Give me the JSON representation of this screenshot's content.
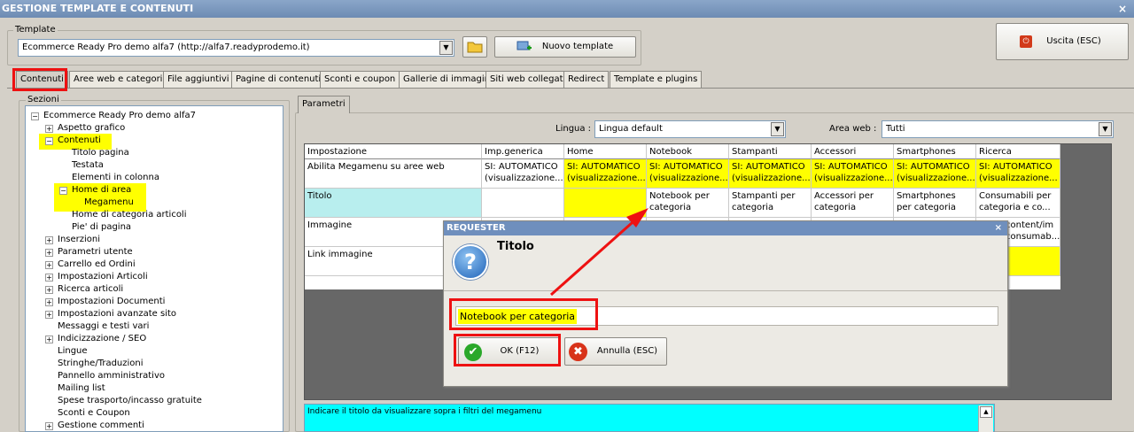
{
  "window": {
    "title": "GESTIONE TEMPLATE E CONTENUTI",
    "close": "×"
  },
  "template_group": {
    "legend": "Template",
    "selected": "Ecommerce Ready Pro demo alfa7 (http://alfa7.readyprodemo.it)",
    "new_button": "Nuovo template"
  },
  "exit_button": "Uscita (ESC)",
  "tabs": [
    "Contenuti",
    "Aree web e categorie",
    "File aggiuntivi",
    "Pagine di contenuti",
    "Sconti e coupon",
    "Gallerie di immagini",
    "Siti web collegati",
    "Redirect",
    "Template e plugins"
  ],
  "sections": {
    "legend": "Sezioni",
    "tree": [
      {
        "label": "Ecommerce Ready Pro demo alfa7",
        "exp": "−"
      },
      {
        "label": "Aspetto grafico",
        "exp": "+"
      },
      {
        "label": "Contenuti",
        "exp": "−"
      },
      {
        "label": "Titolo pagina",
        "exp": ""
      },
      {
        "label": "Testata",
        "exp": ""
      },
      {
        "label": "Elementi in colonna",
        "exp": ""
      },
      {
        "label": "Home di area",
        "exp": "−"
      },
      {
        "label": "Megamenu",
        "exp": ""
      },
      {
        "label": "Home di categoria articoli",
        "exp": ""
      },
      {
        "label": "Pie' di pagina",
        "exp": ""
      },
      {
        "label": "Inserzioni",
        "exp": "+"
      },
      {
        "label": "Parametri utente",
        "exp": "+"
      },
      {
        "label": "Carrello ed Ordini",
        "exp": "+"
      },
      {
        "label": "Impostazioni Articoli",
        "exp": "+"
      },
      {
        "label": "Ricerca articoli",
        "exp": "+"
      },
      {
        "label": "Impostazioni Documenti",
        "exp": "+"
      },
      {
        "label": "Impostazioni avanzate sito",
        "exp": "+"
      },
      {
        "label": "Messaggi e testi vari",
        "exp": ""
      },
      {
        "label": "Indicizzazione / SEO",
        "exp": "+"
      },
      {
        "label": "Lingue",
        "exp": ""
      },
      {
        "label": "Stringhe/Traduzioni",
        "exp": ""
      },
      {
        "label": "Pannello amministrativo",
        "exp": ""
      },
      {
        "label": "Mailing list",
        "exp": ""
      },
      {
        "label": "Spese trasporto/incasso gratuite",
        "exp": ""
      },
      {
        "label": "Sconti e Coupon",
        "exp": ""
      },
      {
        "label": "Gestione commenti",
        "exp": "+"
      }
    ]
  },
  "params": {
    "tab": "Parametri",
    "lingua_label": "Lingua :",
    "lingua_value": "Lingua default",
    "area_label": "Area web :",
    "area_value": "Tutti",
    "columns": [
      "Impostazione",
      "Imp.generica",
      "Home",
      "Notebook",
      "Stampanti",
      "Accessori",
      "Smartphones",
      "Ricerca consum..."
    ],
    "rows": [
      [
        "Abilita Megamenu su aree web",
        "SI: AUTOMATICO (visualizzazione...",
        "SI: AUTOMATICO (visualizzazione...",
        "SI: AUTOMATICO (visualizzazione...",
        "SI: AUTOMATICO (visualizzazione...",
        "SI: AUTOMATICO (visualizzazione...",
        "SI: AUTOMATICO (visualizzazione...",
        "SI: AUTOMATICO (visualizzazione..."
      ],
      [
        "Titolo",
        "",
        "",
        "Notebook per categoria",
        "Stampanti per categoria",
        "Accessori per categoria",
        "Smartphones per categoria",
        "Consumabili per categoria e co..."
      ],
      [
        "Immagine",
        "",
        "",
        "",
        "",
        "",
        "",
        "content/im consumab..."
      ],
      [
        "Link immagine",
        "",
        "",
        "",
        "",
        "",
        "",
        ""
      ]
    ],
    "help_text": "Indicare il titolo da visualizzare sopra i filtri del megamenu"
  },
  "dialog": {
    "title": "REQUESTER",
    "close": "×",
    "heading": "Titolo",
    "icon": "?",
    "input_value": "Notebook per categoria",
    "ok": "OK (F12)",
    "cancel": "Annulla (ESC)"
  },
  "colors": {
    "highlight": "#ffff00",
    "annotation": "#ee1111",
    "help_bg": "#00ffff",
    "titolo_cell": "#b8eeee"
  }
}
